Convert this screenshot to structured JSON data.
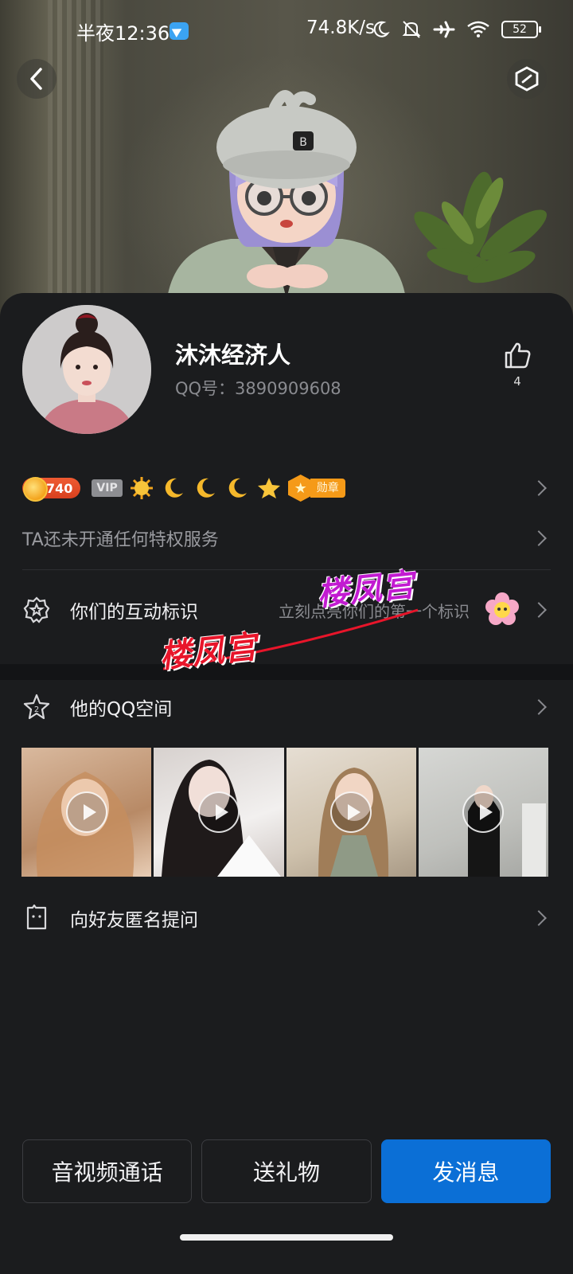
{
  "status_bar": {
    "time": "半夜12:36",
    "net_speed": "74.8K/s",
    "battery": "52",
    "icons": [
      "telegram-icon",
      "moon-icon",
      "mute-bell-icon",
      "airplane-icon",
      "wifi-icon",
      "battery-icon"
    ]
  },
  "header": {
    "back_icon": "back-arrow-icon",
    "settings_icon": "hexagon-edit-icon"
  },
  "profile": {
    "name": "沐沐经济人",
    "qq_label": "QQ号：3890909608",
    "likes": "4"
  },
  "badges": {
    "coins": "740",
    "vip": "VIP",
    "levels": [
      "sun-icon",
      "moon-icon",
      "moon-icon",
      "moon-icon",
      "star-icon"
    ],
    "medal": "勋章"
  },
  "privilege": {
    "text": "TA还未开通任何特权服务"
  },
  "interaction": {
    "label": "你们的互动标识",
    "hint": "立刻点亮你们的第一个标识"
  },
  "qzone": {
    "label": "他的QQ空间",
    "thumbnails": [
      "video",
      "video",
      "video",
      "video"
    ]
  },
  "ask": {
    "label": "向好友匿名提问"
  },
  "watermark": {
    "text1": "楼凤宫",
    "text2": "楼凤宫"
  },
  "actions": {
    "call": "音视频通话",
    "gift": "送礼物",
    "message": "发消息"
  },
  "colors": {
    "background": "#1b1c1e",
    "primary_button": "#0b6fd6",
    "coin_badge": "#e24a25",
    "medal": "#f59a18",
    "secondary_text": "#8a8b90"
  }
}
